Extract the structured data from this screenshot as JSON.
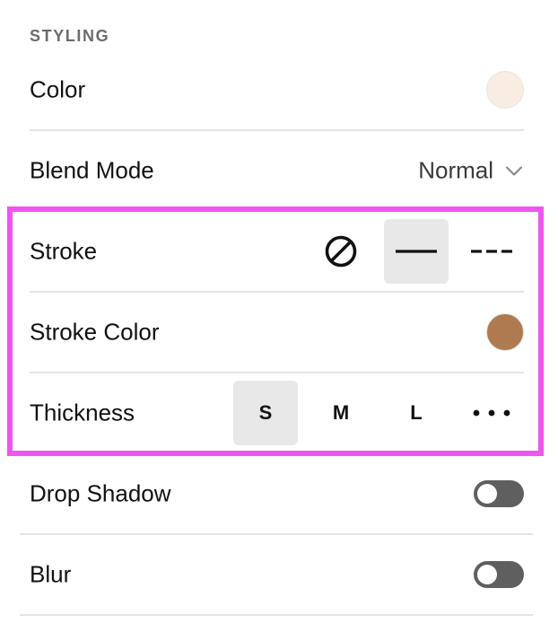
{
  "section": {
    "title": "STYLING"
  },
  "rows": {
    "color": {
      "label": "Color",
      "swatch": "#f9ece0"
    },
    "blend_mode": {
      "label": "Blend Mode",
      "value": "Normal",
      "icon": "chevron-down-icon"
    },
    "stroke": {
      "label": "Stroke",
      "options": [
        {
          "name": "none",
          "icon": "no-stroke-icon",
          "selected": false
        },
        {
          "name": "solid",
          "icon": "solid-line-icon",
          "selected": true
        },
        {
          "name": "dashed",
          "icon": "dashed-line-icon",
          "selected": false
        }
      ]
    },
    "stroke_color": {
      "label": "Stroke Color",
      "swatch": "#b07a50"
    },
    "thickness": {
      "label": "Thickness",
      "options": [
        {
          "label": "S",
          "selected": true
        },
        {
          "label": "M",
          "selected": false
        },
        {
          "label": "L",
          "selected": false
        }
      ],
      "more_icon": "more-dots-icon"
    },
    "drop_shadow": {
      "label": "Drop Shadow",
      "enabled": false
    },
    "blur": {
      "label": "Blur",
      "enabled": false
    }
  },
  "colors": {
    "highlight": "#ee55ee",
    "toggle_off": "#5f5f5f",
    "selected_bg": "#e8e8e8",
    "divider": "#e4e4e4"
  }
}
